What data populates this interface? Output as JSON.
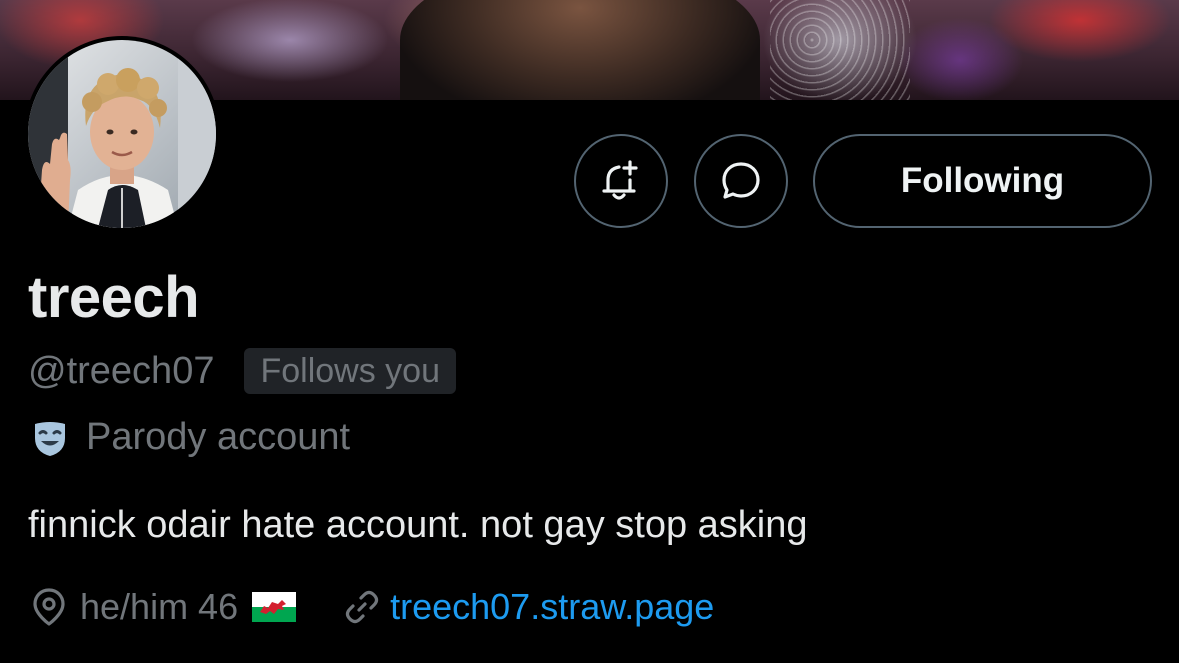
{
  "profile": {
    "display_name": "treech",
    "handle": "@treech07",
    "follows_you_badge": "Follows you",
    "label": "Parody account",
    "bio": "finnick odair hate account. not gay stop asking",
    "location": "he/him 46",
    "link": "treech07.straw.page"
  },
  "actions": {
    "notify_icon": "bell-plus-icon",
    "message_icon": "message-bubble-icon",
    "follow_label": "Following"
  },
  "colors": {
    "background": "#000000",
    "primary_text": "#e7e9ea",
    "secondary_text": "#71767b",
    "link": "#1d9bf0",
    "button_border": "#536471",
    "badge_background": "#202327"
  }
}
